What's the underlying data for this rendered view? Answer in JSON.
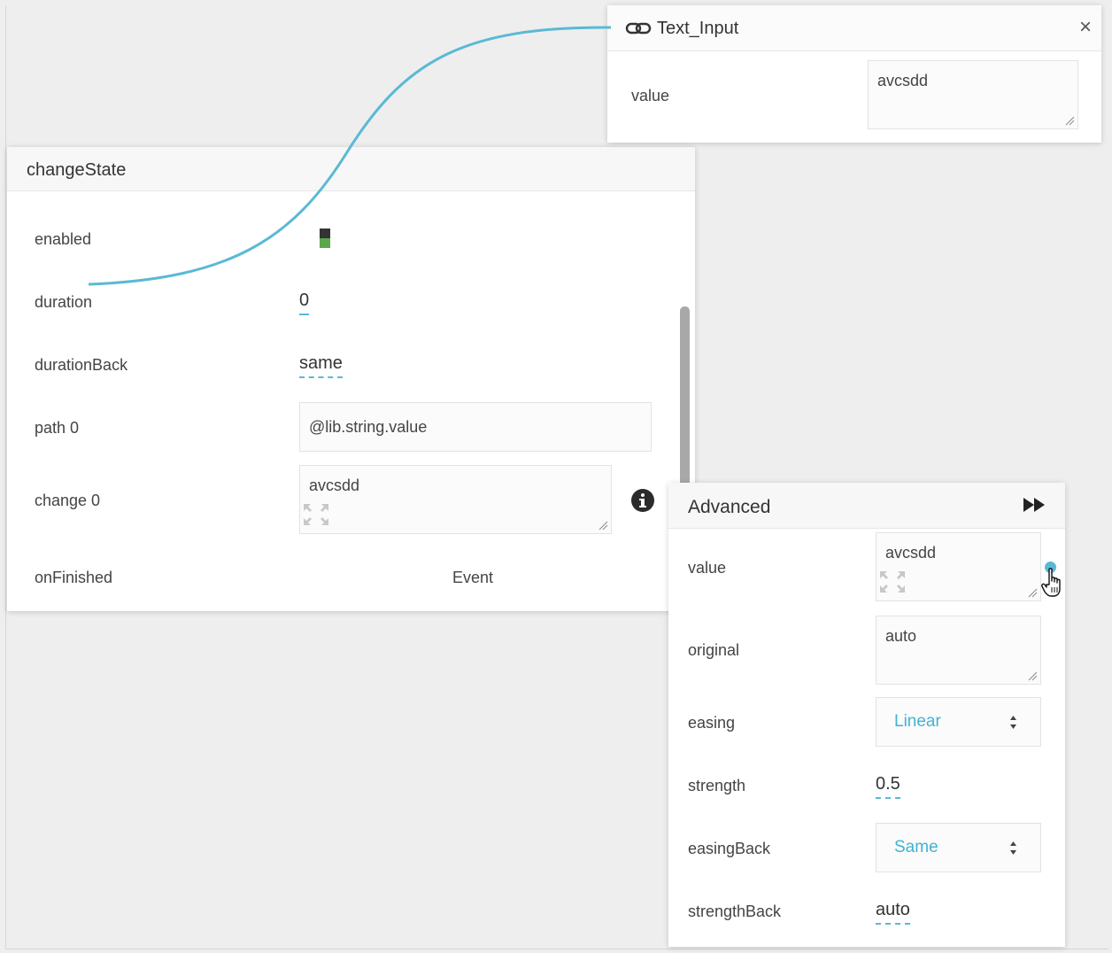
{
  "text_input_panel": {
    "title": "Text_Input",
    "close_symbol": "×",
    "value_label": "value",
    "value_text": "avcsdd"
  },
  "change_state_panel": {
    "title": "changeState",
    "rows": {
      "enabled_label": "enabled",
      "duration_label": "duration",
      "duration_value": "0",
      "duration_back_label": "durationBack",
      "duration_back_value": "same",
      "path_label": "path 0",
      "path_value": "@lib.string.value",
      "change_label": "change 0",
      "change_value": "avcsdd",
      "on_finished_label": "onFinished",
      "on_finished_value": "Event"
    }
  },
  "advanced_panel": {
    "title": "Advanced",
    "value_label": "value",
    "value_text": "avcsdd",
    "original_label": "original",
    "original_text": "auto",
    "easing_label": "easing",
    "easing_value": "Linear",
    "strength_label": "strength",
    "strength_value": "0.5",
    "easing_back_label": "easingBack",
    "easing_back_value": "Same",
    "strength_back_label": "strengthBack",
    "strength_back_value": "auto"
  },
  "colors": {
    "connection_wire": "#5ab9d4",
    "accent": "#41b3d2",
    "toggle_on": "#5aa84a"
  }
}
